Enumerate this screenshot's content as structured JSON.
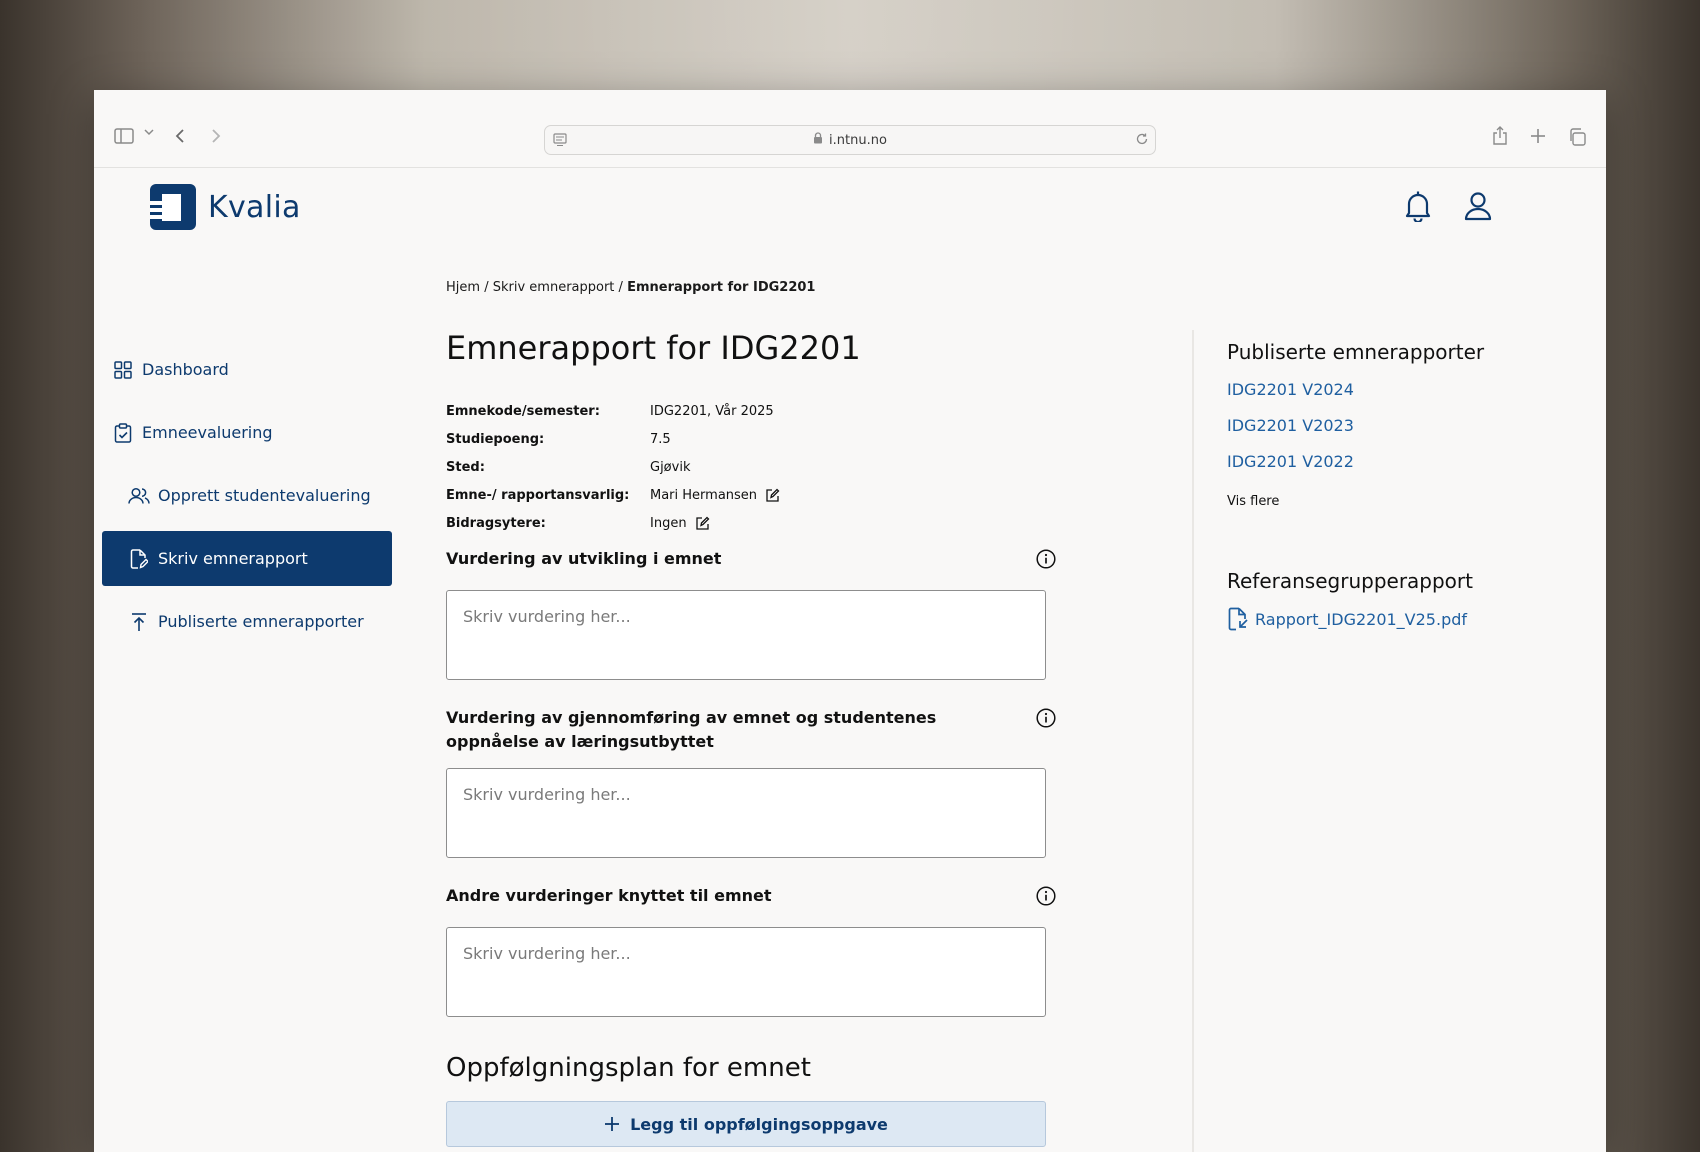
{
  "browser": {
    "url": "i.ntnu.no"
  },
  "app": {
    "name": "Kvalia"
  },
  "sidebar": {
    "items": [
      {
        "label": "Dashboard",
        "icon": "grid-icon",
        "active": false
      },
      {
        "label": "Emneevaluering",
        "icon": "clipboard-check-icon",
        "active": false
      },
      {
        "label": "Opprett studentevaluering",
        "icon": "users-icon",
        "active": false
      },
      {
        "label": "Skriv emnerapport",
        "icon": "document-edit-icon",
        "active": true
      },
      {
        "label": "Publiserte emnerapporter",
        "icon": "upload-icon",
        "active": false
      }
    ]
  },
  "breadcrumb": {
    "home": "Hjem",
    "sep1": "/",
    "parent": "Skriv emnerapport",
    "sep2": "/",
    "current": "Emnerapport for IDG2201"
  },
  "main": {
    "title": "Emnerapport for IDG2201",
    "meta": [
      {
        "key": "Emnekode/semester:",
        "value": "IDG2201, Vår 2025"
      },
      {
        "key": "Studiepoeng:",
        "value": "7.5"
      },
      {
        "key": "Sted:",
        "value": "Gjøvik"
      },
      {
        "key": "Emne-/ rapportansvarlig:",
        "value": "Mari Hermansen"
      },
      {
        "key": "Bidragsytere:",
        "value": "Ingen"
      }
    ],
    "fields": [
      {
        "label": "Vurdering av utvikling i emnet",
        "placeholder": "Skriv vurdering her..."
      },
      {
        "label": "Vurdering av gjennomføring av emnet og studentenes oppnåelse av læringsutbyttet",
        "placeholder": "Skriv vurdering her..."
      },
      {
        "label": "Andre vurderinger knyttet til emnet",
        "placeholder": "Skriv vurdering her..."
      }
    ],
    "followup_title": "Oppfølgningsplan for emnet",
    "add_task_label": "Legg til oppfølgingsoppgave"
  },
  "aside": {
    "published_title": "Publiserte emnerapporter",
    "published_links": [
      "IDG2201 V2024",
      "IDG2201 V2023",
      "IDG2201 V2022"
    ],
    "show_more": "Vis flere",
    "reference_title": "Referansegrupperapport",
    "reference_file": "Rapport_IDG2201_V25.pdf"
  },
  "colors": {
    "brand": "#0d3a6e",
    "link": "#1f5fa0",
    "button_bg": "#dde8f3"
  }
}
